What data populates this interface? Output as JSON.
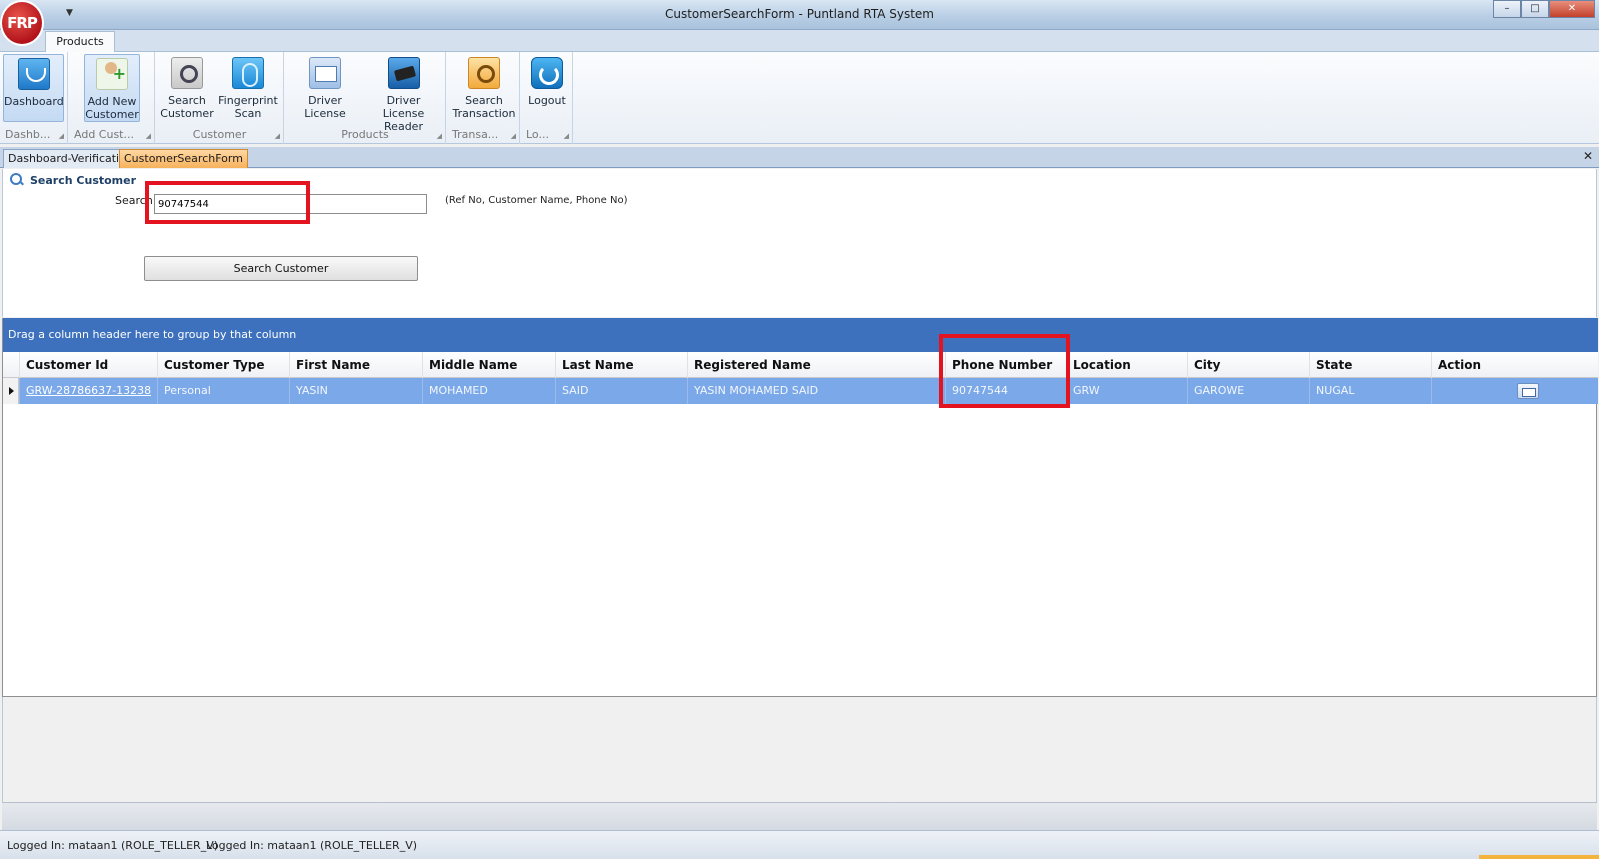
{
  "window": {
    "title": "CustomerSearchForm - Puntland RTA System",
    "logo_text": "FRP",
    "controls": {
      "minimize": "–",
      "maximize": "□",
      "close": "✕"
    }
  },
  "ribbon": {
    "tab": "Products",
    "groups": [
      {
        "label": "Dashb...",
        "buttons": [
          {
            "label_lines": [
              "Dashboard"
            ],
            "icon": "dashboard-icon"
          }
        ]
      },
      {
        "label": "Add Cust...",
        "buttons": [
          {
            "label_lines": [
              "Add New",
              "Customer"
            ],
            "icon": "add-user-icon"
          }
        ]
      },
      {
        "label": "Customer",
        "buttons": [
          {
            "label_lines": [
              "Search",
              "Customer"
            ],
            "icon": "search-customer-icon"
          },
          {
            "label_lines": [
              "Fingerprint",
              "Scan"
            ],
            "icon": "fingerprint-icon"
          }
        ]
      },
      {
        "label": "Products",
        "buttons": [
          {
            "label_lines": [
              "Driver License"
            ],
            "icon": "driver-license-icon"
          },
          {
            "label_lines": [
              "Driver License",
              "Reader"
            ],
            "icon": "card-reader-icon"
          }
        ]
      },
      {
        "label": "Transa...",
        "buttons": [
          {
            "label_lines": [
              "Search",
              "Transaction"
            ],
            "icon": "search-transaction-icon"
          }
        ]
      },
      {
        "label": "Lo...",
        "buttons": [
          {
            "label_lines": [
              "Logout"
            ],
            "icon": "logout-icon"
          }
        ]
      }
    ]
  },
  "doc_tabs": [
    {
      "label": "Dashboard-Verification",
      "active": false
    },
    {
      "label": "CustomerSearchForm",
      "active": true
    }
  ],
  "search_form": {
    "title": "Search Customer",
    "search_label": "Search",
    "search_value": "90747544",
    "hint": "(Ref No, Customer Name, Phone No)",
    "button_label": "Search Customer"
  },
  "grid": {
    "group_panel_text": "Drag a column header here to group by that column",
    "columns": [
      "Customer Id",
      "Customer Type",
      "First Name",
      "Middle Name",
      "Last Name",
      "Registered Name",
      "Phone Number",
      "Location",
      "City",
      "State",
      "Action"
    ],
    "rows": [
      {
        "customer_id": "GRW-28786637-13238",
        "customer_type": "Personal",
        "first_name": "YASIN",
        "middle_name": "MOHAMED",
        "last_name": "SAID",
        "registered_name": "YASIN MOHAMED SAID",
        "phone_number": "90747544",
        "location": "GRW",
        "city": "GAROWE",
        "state": "NUGAL",
        "action_icon": "id-card-icon"
      }
    ]
  },
  "status_bar": {
    "items": [
      "Logged In: mataan1 (ROLE_TELLER_V)",
      "Logged In: mataan1 (ROLE_TELLER_V)"
    ]
  },
  "colors": {
    "highlight_box": "#e3141f",
    "group_panel": "#3e71bd",
    "selected_row": "#7aa8e9",
    "active_doc_tab": "#f6b25c"
  }
}
